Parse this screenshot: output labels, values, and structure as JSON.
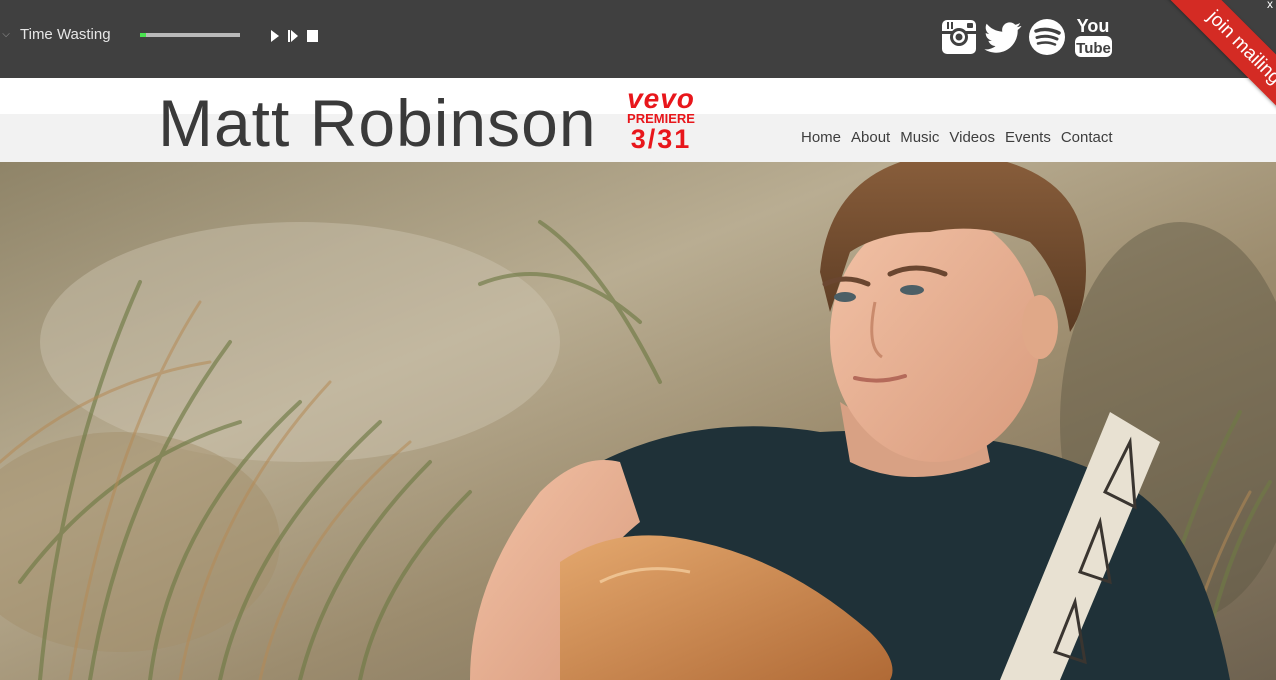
{
  "player": {
    "track_title": "Time Wasting",
    "progress": 0.06,
    "colors": {
      "bar": "#404040",
      "progress_fill": "#49e34f",
      "progress_track": "#b9b9b9"
    },
    "controls": [
      {
        "icon": "play-icon"
      },
      {
        "icon": "next-track-icon"
      },
      {
        "icon": "stop-icon"
      }
    ],
    "social": [
      {
        "icon": "instagram-icon"
      },
      {
        "icon": "twitter-icon"
      },
      {
        "icon": "spotify-icon"
      },
      {
        "icon": "youtube-icon",
        "text_top": "You",
        "text_bottom": "Tube"
      }
    ]
  },
  "ribbon": {
    "label": "join mailing list",
    "close": "x",
    "color": "#d42b24"
  },
  "header": {
    "site_title": "Matt Robinson",
    "badge": {
      "logo": "vevo",
      "subtitle": "PREMIERE",
      "date": "3/31",
      "color": "#e8161b"
    },
    "nav": [
      {
        "label": "Home"
      },
      {
        "label": "About"
      },
      {
        "label": "Music"
      },
      {
        "label": "Videos"
      },
      {
        "label": "Events"
      },
      {
        "label": "Contact"
      }
    ]
  }
}
